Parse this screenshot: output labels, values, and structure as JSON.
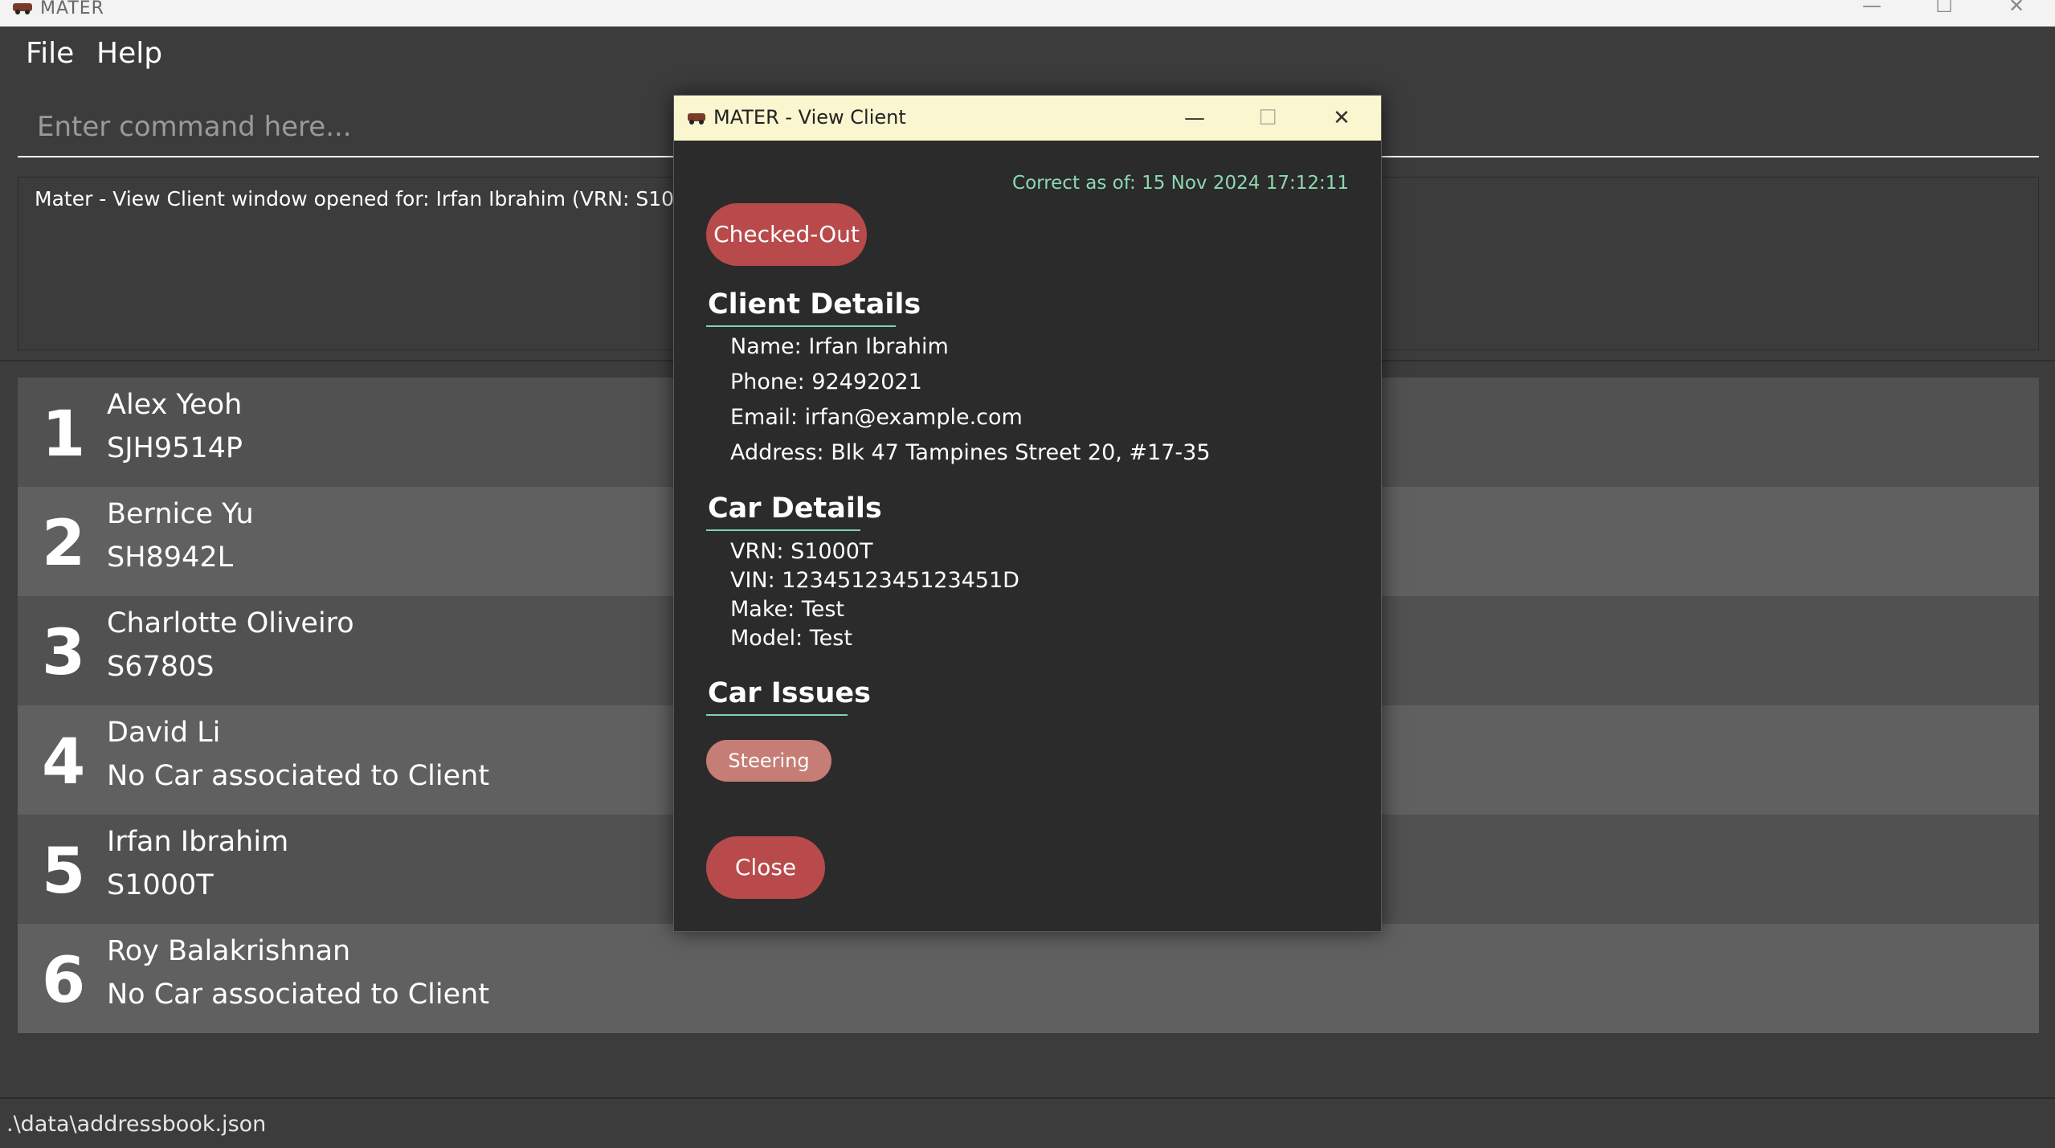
{
  "window": {
    "title": "MATER",
    "minimize_glyph": "—",
    "maximize_glyph": "☐",
    "close_glyph": "✕"
  },
  "menu": {
    "file": "File",
    "help": "Help"
  },
  "command": {
    "placeholder": "Enter command here..."
  },
  "result": {
    "message": "Mater - View Client window opened for: Irfan Ibrahim (VRN: S1000T)"
  },
  "clients": [
    {
      "index": "1",
      "name": "Alex Yeoh",
      "plate": "SJH9514P"
    },
    {
      "index": "2",
      "name": "Bernice Yu",
      "plate": "SH8942L"
    },
    {
      "index": "3",
      "name": "Charlotte Oliveiro",
      "plate": "S6780S"
    },
    {
      "index": "4",
      "name": "David Li",
      "plate": "No Car associated to Client"
    },
    {
      "index": "5",
      "name": "Irfan Ibrahim",
      "plate": "S1000T"
    },
    {
      "index": "6",
      "name": "Roy Balakrishnan",
      "plate": "No Car associated to Client"
    }
  ],
  "status_bar": {
    "path": ".\\data\\addressbook.json"
  },
  "dialog": {
    "title": "MATER - View Client",
    "minimize_glyph": "—",
    "maximize_glyph": "☐",
    "close_glyph": "✕",
    "timestamp": "Correct as of: 15 Nov 2024 17:12:11",
    "status_label": "Checked-Out",
    "client_heading": "Client Details",
    "client_name": "Name: Irfan Ibrahim",
    "client_phone": "Phone: 92492021",
    "client_email": "Email: irfan@example.com",
    "client_address": "Address: Blk 47 Tampines Street 20, #17-35",
    "car_heading": "Car Details",
    "car_vrn": "VRN: S1000T",
    "car_vin": "VIN: 1234512345123451D",
    "car_make": "Make: Test",
    "car_model": "Model: Test",
    "issues_heading": "Car Issues",
    "issues": [
      "Steering"
    ],
    "close_label": "Close"
  },
  "colors": {
    "accent_red": "#b84a4b",
    "tag_red": "#c57d75",
    "timestamp_green": "#8dd9b0",
    "dialog_titlebar": "#faf6cf"
  },
  "icons": {
    "app_logo": "car-icon"
  }
}
